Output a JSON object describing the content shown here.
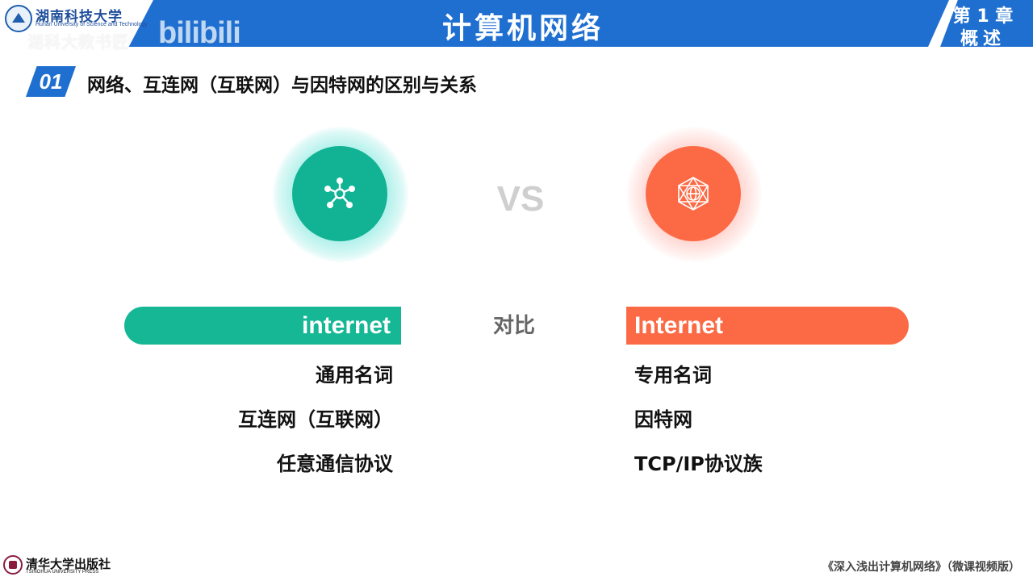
{
  "header": {
    "course_title": "计算机网络",
    "chapter_line1": "第 1 章",
    "chapter_line2": "概述",
    "university_cn": "湖南科技大学",
    "university_en": "Hunan University of Science and Technology",
    "watermark_text": "湖科大教书匠",
    "watermark_brand": "bilibili"
  },
  "section": {
    "number": "01",
    "title": "网络、互连网（互联网）与因特网的区别与关系"
  },
  "comparison": {
    "vs_label": "VS",
    "compare_label": "对比",
    "left": {
      "icon": "network-nodes-icon",
      "color": "#11b394",
      "bar_label": "internet",
      "items": [
        "通用名词",
        "互连网（互联网）",
        "任意通信协议"
      ]
    },
    "right": {
      "icon": "globe-network-icon",
      "color": "#fb6a45",
      "bar_label": "Internet",
      "items": [
        "专用名词",
        "因特网",
        "TCP/IP协议族"
      ]
    }
  },
  "footer": {
    "publisher": "清华大学出版社",
    "publisher_en": "TSINGHUA UNIVERSITY PRESS",
    "book_title": "《深入浅出计算机网络》（微课视频版）"
  },
  "colors": {
    "header_blue": "#1f6fd1",
    "teal": "#11b394",
    "orange": "#fb6a45"
  }
}
